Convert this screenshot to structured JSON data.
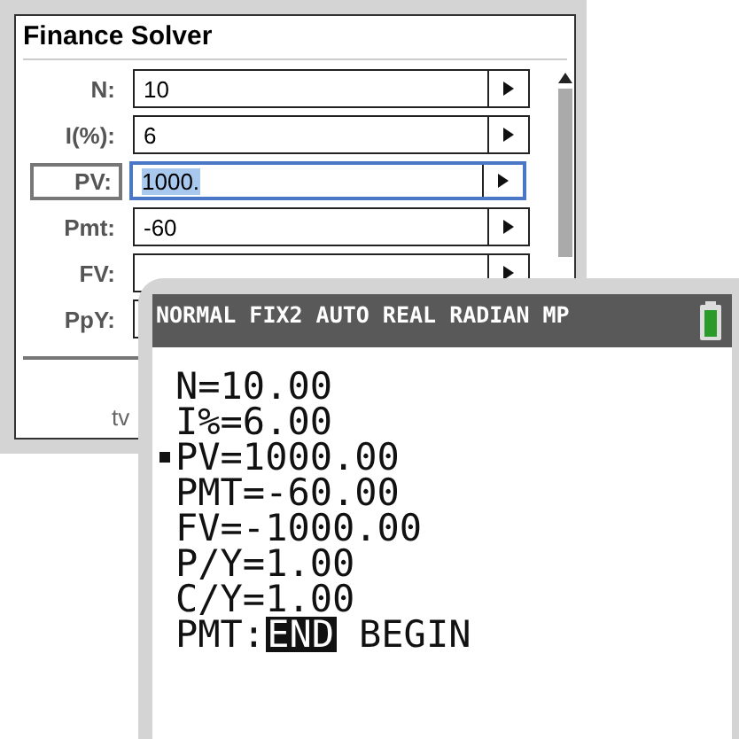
{
  "solver": {
    "title": "Finance Solver",
    "fields": [
      {
        "label": "N:",
        "value": "10",
        "focused": false
      },
      {
        "label": "I(%):",
        "value": "6",
        "focused": false
      },
      {
        "label": "PV:",
        "value": "1000.",
        "focused": true
      },
      {
        "label": "Pmt:",
        "value": "-60",
        "focused": false
      },
      {
        "label": "FV:",
        "focused": false
      },
      {
        "label": "PpY:",
        "focused": false
      }
    ],
    "footer_text": "tv"
  },
  "calculator": {
    "status": "NORMAL FIX2 AUTO REAL RADIAN MP",
    "lines": [
      {
        "text": "N=10.00",
        "selected": false
      },
      {
        "text": "I%=6.00",
        "selected": false
      },
      {
        "text": "PV=1000.00",
        "selected": true
      },
      {
        "text": "PMT=-60.00",
        "selected": false
      },
      {
        "text": "FV=-1000.00",
        "selected": false
      },
      {
        "text": "P/Y=1.00",
        "selected": false
      },
      {
        "text": "C/Y=1.00",
        "selected": false
      }
    ],
    "pmt_label": "PMT:",
    "pmt_options": [
      {
        "label": "END",
        "selected": true
      },
      {
        "label": "BEGIN",
        "selected": false
      }
    ]
  }
}
